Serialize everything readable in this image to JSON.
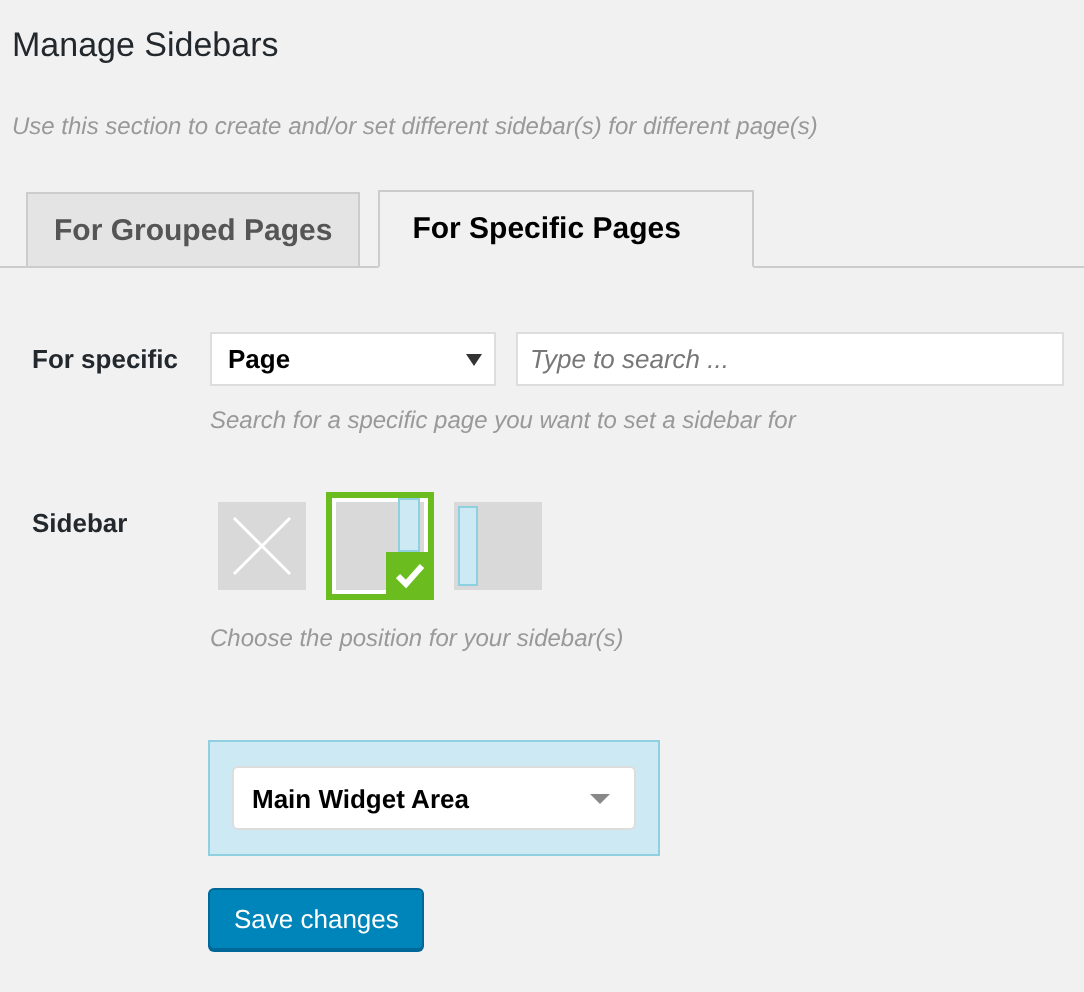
{
  "title": "Manage Sidebars",
  "description": "Use this section to create and/or set different sidebar(s) for different page(s)",
  "tabs": [
    {
      "label": "For Grouped Pages",
      "selected": false
    },
    {
      "label": "For Specific Pages",
      "selected": true
    }
  ],
  "for_specific": {
    "label": "For specific",
    "select_value": "Page",
    "search_placeholder": "Type to search ...",
    "help": "Search for a specific page you want to set a sidebar for"
  },
  "sidebar": {
    "label": "Sidebar",
    "options": [
      {
        "kind": "none",
        "selected": false
      },
      {
        "kind": "right",
        "selected": true
      },
      {
        "kind": "left",
        "selected": false
      }
    ],
    "help": "Choose the position for your sidebar(s)"
  },
  "widget_area": {
    "value": "Main Widget Area"
  },
  "save_button": "Save changes"
}
